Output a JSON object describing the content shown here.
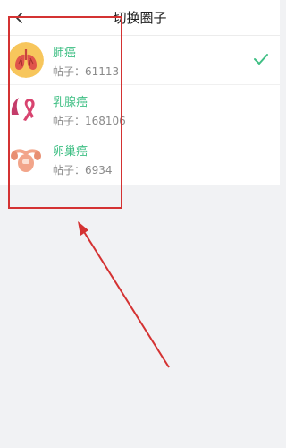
{
  "header": {
    "title": "切换圈子",
    "back_icon": "chevron-left-icon"
  },
  "circles": [
    {
      "name": "肺癌",
      "posts": "帖子：61113",
      "icon": "lungs-icon",
      "selected": true
    },
    {
      "name": "乳腺癌",
      "posts": "帖子：168106",
      "icon": "pink-ribbon-icon",
      "selected": false
    },
    {
      "name": "卵巢癌",
      "posts": "帖子：6934",
      "icon": "ovary-icon",
      "selected": false
    }
  ],
  "colors": {
    "accent": "#3fbf84",
    "annotation": "#d43232",
    "background": "#f1f2f4"
  }
}
